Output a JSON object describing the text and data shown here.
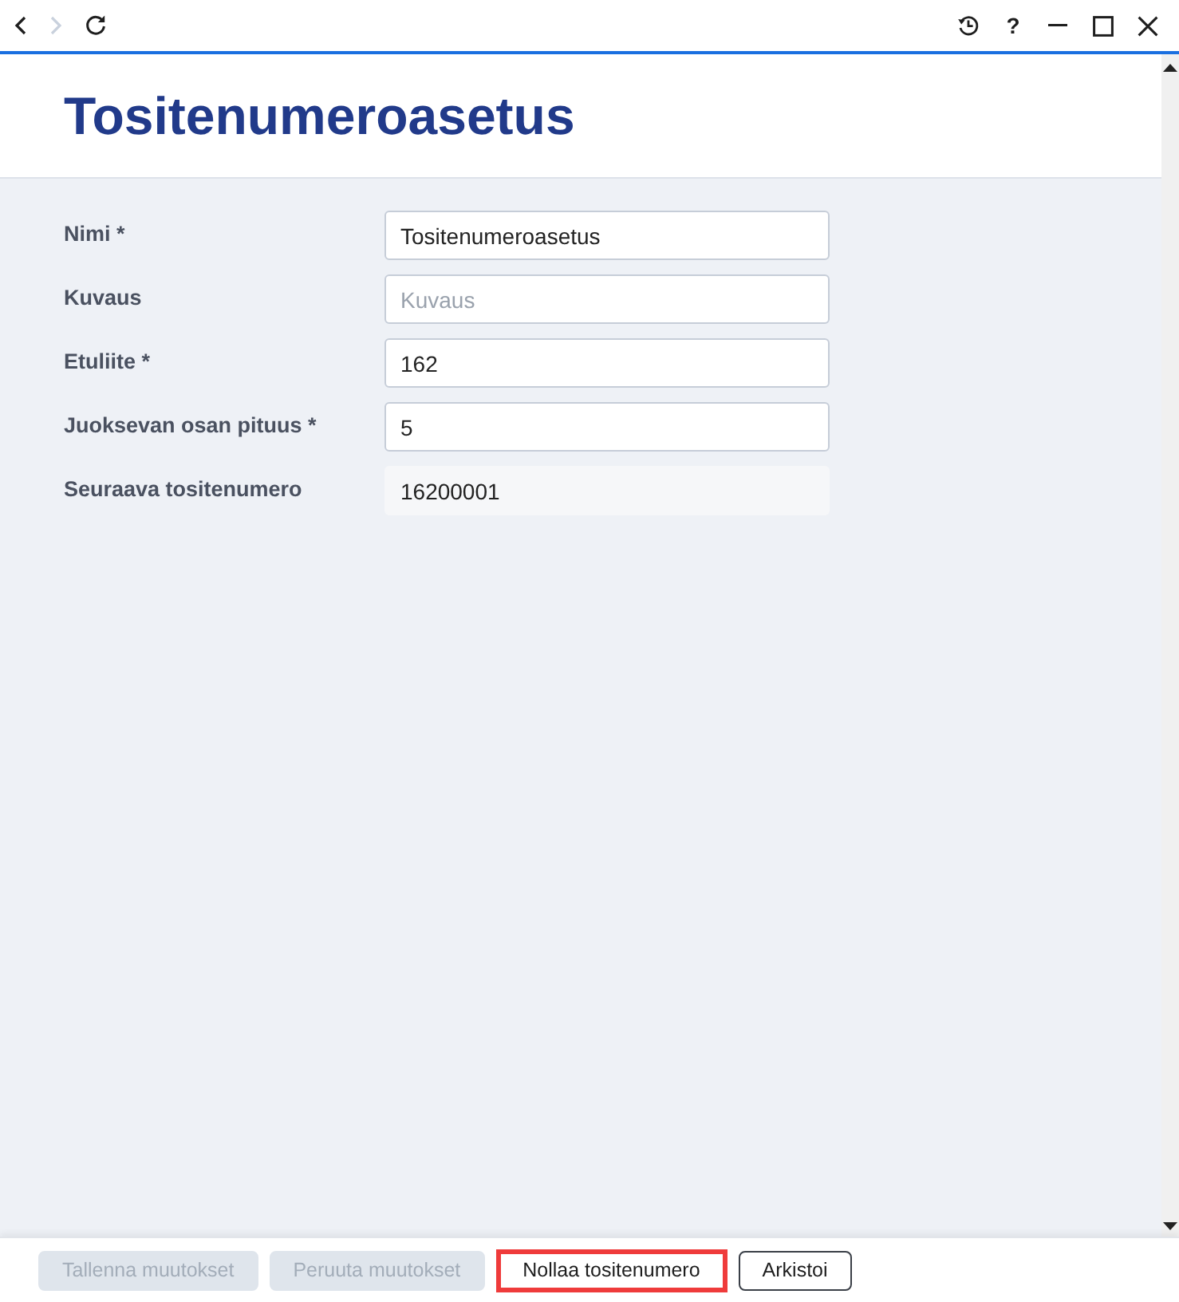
{
  "toolbar": {
    "nav": [
      {
        "kind": "back",
        "disabled": false
      },
      {
        "kind": "forward",
        "disabled": true
      },
      {
        "kind": "refresh",
        "disabled": false
      }
    ],
    "help_label": "?"
  },
  "header": {
    "title": "Tositenumeroasetus"
  },
  "form": {
    "fields": [
      {
        "label": "Nimi *",
        "value": "Tositenumeroasetus",
        "readonly": false
      },
      {
        "label": "Kuvaus",
        "placeholder": "Kuvaus",
        "readonly": false
      },
      {
        "label": "Etuliite *",
        "value": "162",
        "readonly": false
      },
      {
        "label": "Juoksevan osan pituus *",
        "value": "5",
        "readonly": false
      },
      {
        "label": "Seuraava tositenumero",
        "value": "16200001",
        "readonly": true
      }
    ]
  },
  "footer": {
    "buttons": [
      {
        "label": "Tallenna muutokset",
        "disabled": true,
        "highlighted": false
      },
      {
        "label": "Peruuta muutokset",
        "disabled": true,
        "highlighted": false
      },
      {
        "label": "Nollaa tositenumero",
        "disabled": false,
        "highlighted": true
      },
      {
        "label": "Arkistoi",
        "disabled": false,
        "highlighted": false
      }
    ]
  }
}
